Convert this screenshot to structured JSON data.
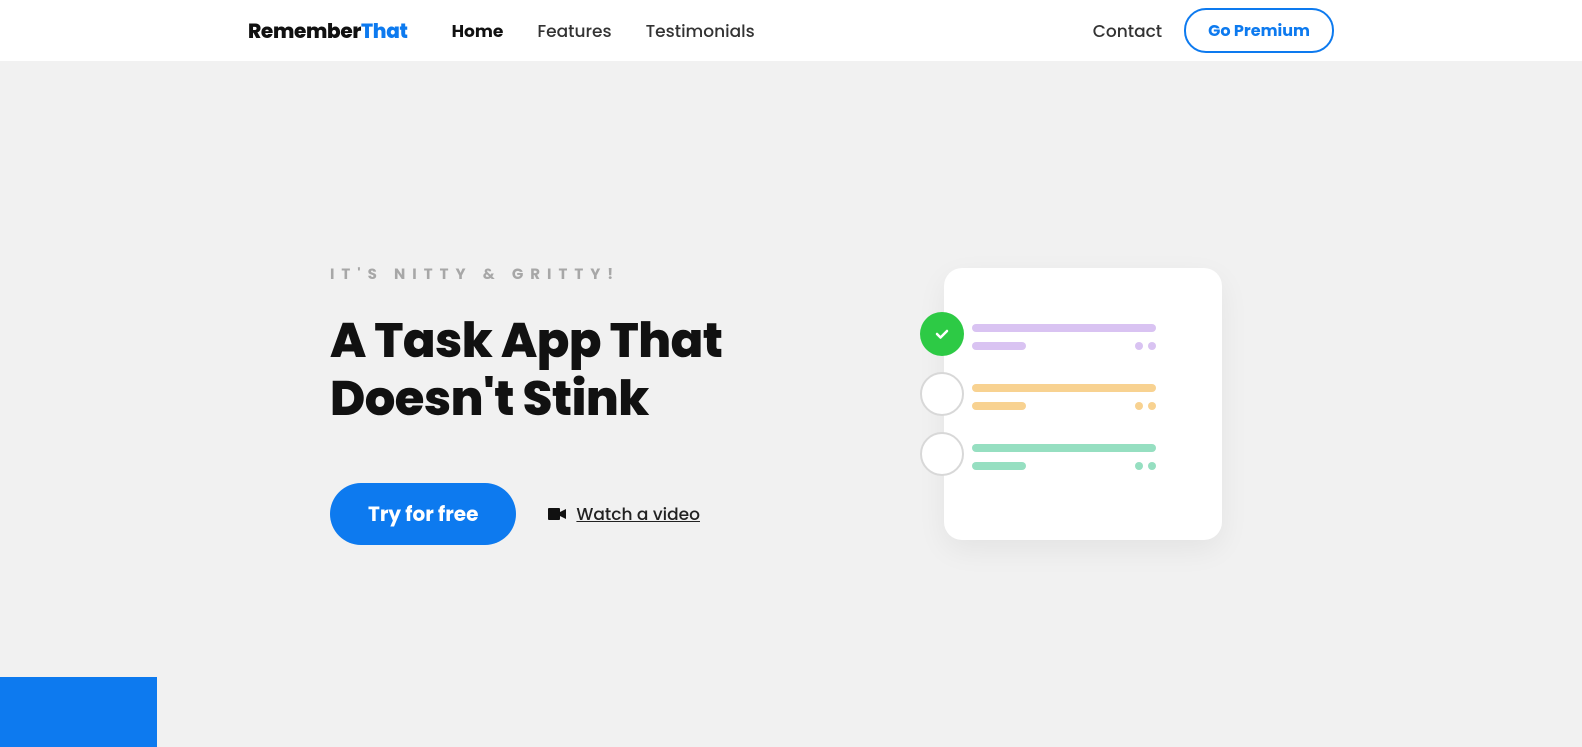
{
  "logo": {
    "first": "Remember",
    "second": "That"
  },
  "nav": {
    "items": [
      {
        "label": "Home",
        "active": true
      },
      {
        "label": "Features",
        "active": false
      },
      {
        "label": "Testimonials",
        "active": false
      }
    ]
  },
  "header_right": {
    "contact": "Contact",
    "premium_label": "Go Premium"
  },
  "hero": {
    "tagline": "IT'S NITTY & GRITTY!",
    "title": "A Task App That Doesn't Stink",
    "try_label": "Try for free",
    "watch_label": "Watch a video"
  },
  "colors": {
    "primary": "#0d7aef",
    "bg": "#f1f1f1",
    "green_check": "#2dca45"
  }
}
